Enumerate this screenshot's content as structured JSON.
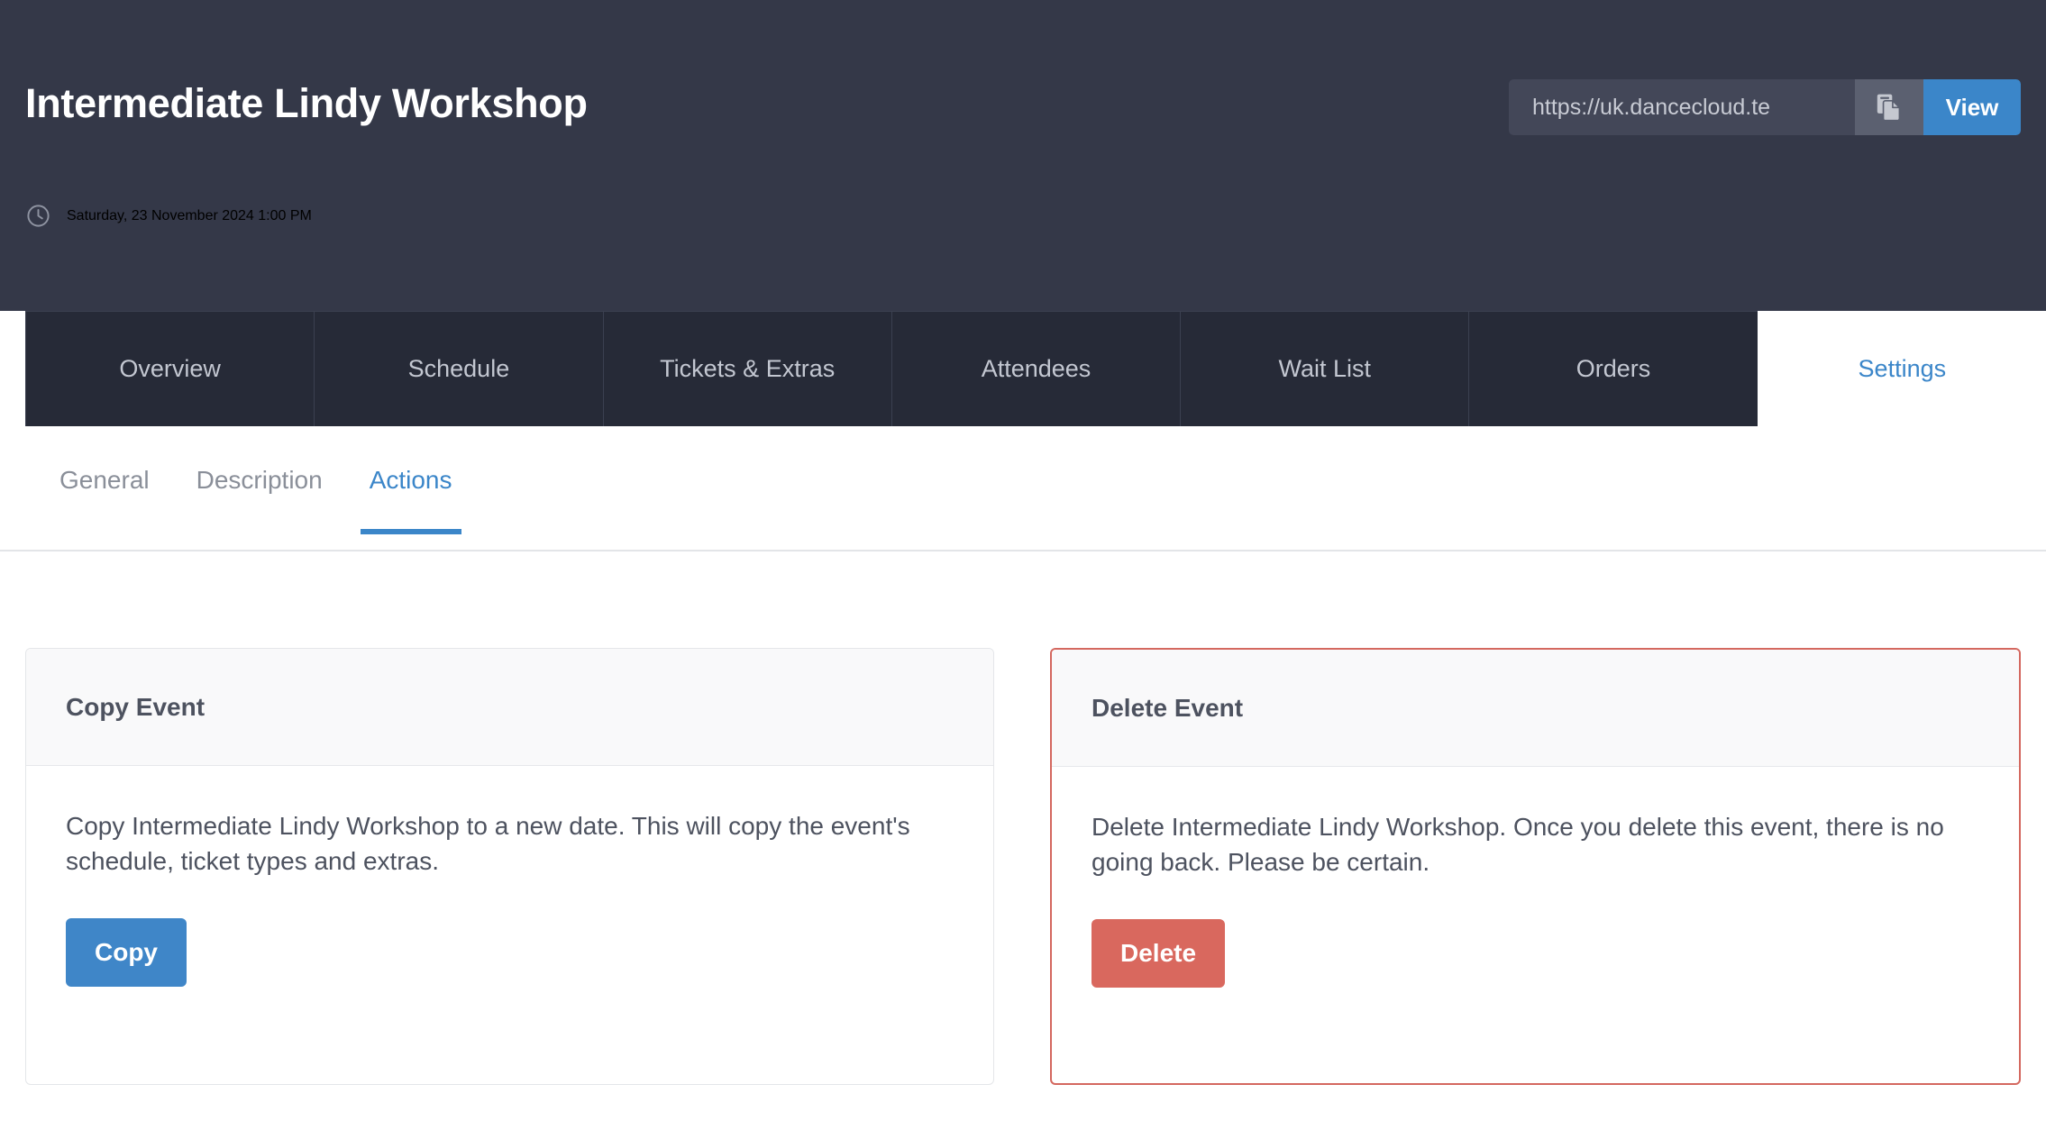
{
  "header": {
    "event_title": "Intermediate Lindy Workshop",
    "clock_icon": "clock-icon",
    "event_datetime": "Saturday, 23 November 2024 1:00 PM",
    "url_value": "https://uk.dancecloud.te",
    "url_placeholder": "https://uk.dancecloud.te",
    "copy_icon": "copy-icon",
    "view_label": "View",
    "background_color": "#343848",
    "accent_color": "#3b86c9"
  },
  "tabs": [
    {
      "label": "Overview",
      "active": false
    },
    {
      "label": "Schedule",
      "active": false
    },
    {
      "label": "Tickets & Extras",
      "active": false
    },
    {
      "label": "Attendees",
      "active": false
    },
    {
      "label": "Wait List",
      "active": false
    },
    {
      "label": "Orders",
      "active": false
    },
    {
      "label": "Settings",
      "active": true
    }
  ],
  "subtabs": [
    {
      "label": "General",
      "active": false
    },
    {
      "label": "Description",
      "active": false
    },
    {
      "label": "Actions",
      "active": true
    }
  ],
  "cards": [
    {
      "title": "Copy Event",
      "body": "Copy Intermediate Lindy Workshop to a new date. This will copy the event's schedule, ticket types and extras.",
      "button_label": "Copy",
      "button_color": "#3f86c8",
      "danger": false
    },
    {
      "title": "Delete Event",
      "body": "Delete Intermediate Lindy Workshop. Once you delete this event, there is no going back. Please be certain.",
      "button_label": "Delete",
      "button_color": "#d9685e",
      "border_color": "#d4685f",
      "danger": true
    }
  ]
}
